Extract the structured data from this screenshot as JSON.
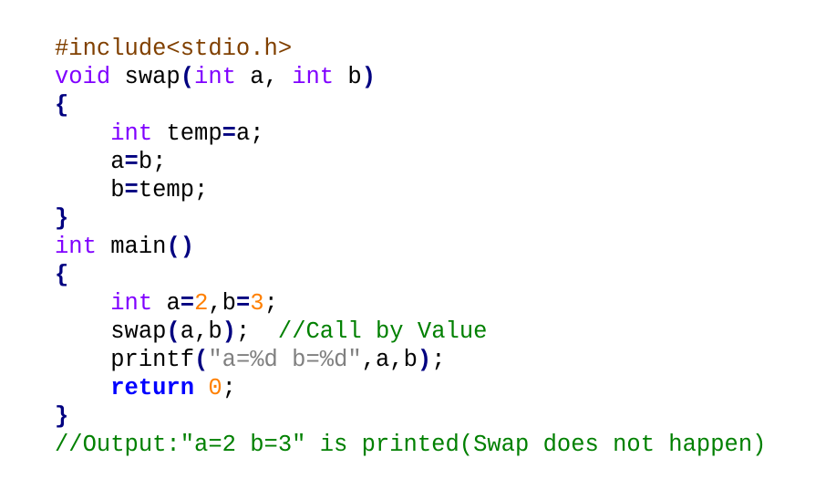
{
  "colors": {
    "preprocessor": "#804000",
    "type_keyword": "#8000ff",
    "keyword": "#0000ff",
    "operator": "#000080",
    "number": "#ff8000",
    "string": "#808080",
    "comment": "#008000",
    "identifier": "#000000",
    "background": "#ffffff"
  },
  "code": {
    "lines": [
      [
        {
          "t": "#include<stdio.h>",
          "k": "preproc"
        }
      ],
      [
        {
          "t": "void",
          "k": "type"
        },
        {
          "t": " swap",
          "k": "ident"
        },
        {
          "t": "(",
          "k": "op"
        },
        {
          "t": "int",
          "k": "type"
        },
        {
          "t": " a, ",
          "k": "ident"
        },
        {
          "t": "int",
          "k": "type"
        },
        {
          "t": " b",
          "k": "ident"
        },
        {
          "t": ")",
          "k": "op"
        }
      ],
      [
        {
          "t": "{",
          "k": "op"
        }
      ],
      [
        {
          "t": "    ",
          "k": "ident"
        },
        {
          "t": "int",
          "k": "type"
        },
        {
          "t": " temp",
          "k": "ident"
        },
        {
          "t": "=",
          "k": "op"
        },
        {
          "t": "a;",
          "k": "ident"
        }
      ],
      [
        {
          "t": "    a",
          "k": "ident"
        },
        {
          "t": "=",
          "k": "op"
        },
        {
          "t": "b;",
          "k": "ident"
        }
      ],
      [
        {
          "t": "    b",
          "k": "ident"
        },
        {
          "t": "=",
          "k": "op"
        },
        {
          "t": "temp;",
          "k": "ident"
        }
      ],
      [
        {
          "t": "}",
          "k": "op"
        }
      ],
      [
        {
          "t": "int",
          "k": "type"
        },
        {
          "t": " main",
          "k": "ident"
        },
        {
          "t": "()",
          "k": "op"
        }
      ],
      [
        {
          "t": "{",
          "k": "op"
        }
      ],
      [
        {
          "t": "    ",
          "k": "ident"
        },
        {
          "t": "int",
          "k": "type"
        },
        {
          "t": " a",
          "k": "ident"
        },
        {
          "t": "=",
          "k": "op"
        },
        {
          "t": "2",
          "k": "num"
        },
        {
          "t": ",b",
          "k": "ident"
        },
        {
          "t": "=",
          "k": "op"
        },
        {
          "t": "3",
          "k": "num"
        },
        {
          "t": ";",
          "k": "ident"
        }
      ],
      [
        {
          "t": "    swap",
          "k": "ident"
        },
        {
          "t": "(",
          "k": "op"
        },
        {
          "t": "a,b",
          "k": "ident"
        },
        {
          "t": ")",
          "k": "op"
        },
        {
          "t": ";  ",
          "k": "ident"
        },
        {
          "t": "//Call by Value",
          "k": "comment"
        }
      ],
      [
        {
          "t": "    printf",
          "k": "ident"
        },
        {
          "t": "(",
          "k": "op"
        },
        {
          "t": "\"a=%d b=%d\"",
          "k": "str"
        },
        {
          "t": ",a,b",
          "k": "ident"
        },
        {
          "t": ")",
          "k": "op"
        },
        {
          "t": ";",
          "k": "ident"
        }
      ],
      [
        {
          "t": "    ",
          "k": "ident"
        },
        {
          "t": "return",
          "k": "kw"
        },
        {
          "t": " ",
          "k": "ident"
        },
        {
          "t": "0",
          "k": "num"
        },
        {
          "t": ";",
          "k": "ident"
        }
      ],
      [
        {
          "t": "}",
          "k": "op"
        }
      ],
      [
        {
          "t": "//Output:\"a=2 b=3\" is printed(Swap does not happen)",
          "k": "comment"
        }
      ]
    ]
  }
}
